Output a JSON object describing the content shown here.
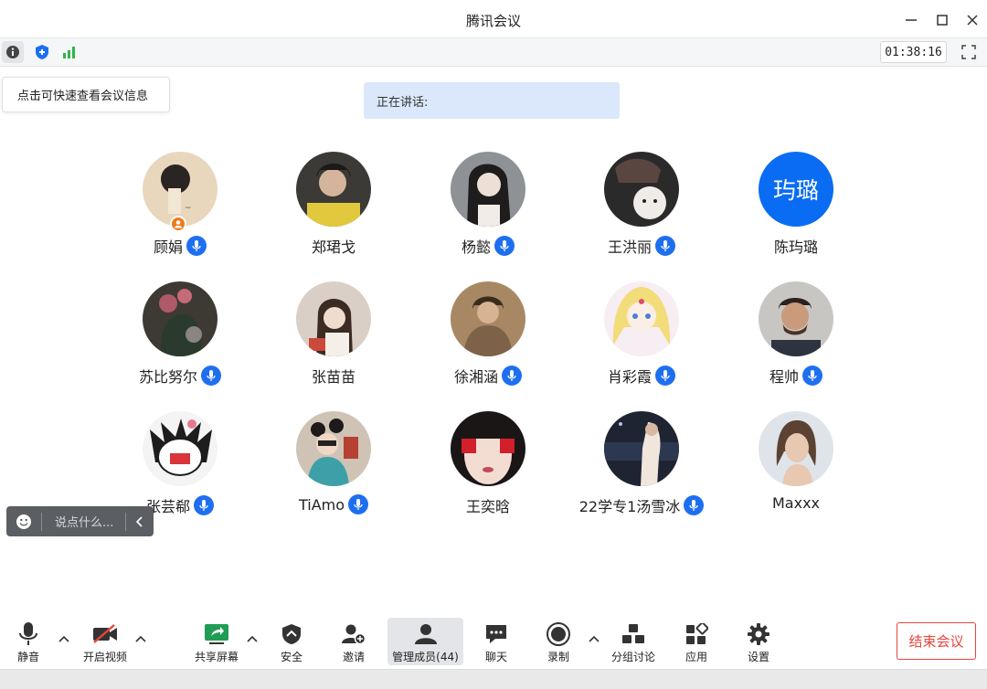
{
  "window": {
    "title": "腾讯会议"
  },
  "infobar": {
    "timer": "01:38:16"
  },
  "tooltip": {
    "text": "点击可快速查看会议信息"
  },
  "speaking": {
    "label": "正在讲话:"
  },
  "participants": [
    {
      "name": "顾娟",
      "mic": true,
      "host": true,
      "avatar_initials": ""
    },
    {
      "name": "郑珺戈",
      "mic": false,
      "host": false,
      "avatar_initials": ""
    },
    {
      "name": "杨懿",
      "mic": true,
      "host": false,
      "avatar_initials": ""
    },
    {
      "name": "王洪丽",
      "mic": true,
      "host": false,
      "avatar_initials": ""
    },
    {
      "name": "陈玙璐",
      "mic": false,
      "host": false,
      "avatar_initials": "玙璐"
    },
    {
      "name": "苏比努尔",
      "mic": true,
      "host": false,
      "avatar_initials": ""
    },
    {
      "name": "张苗苗",
      "mic": false,
      "host": false,
      "avatar_initials": ""
    },
    {
      "name": "徐湘涵",
      "mic": true,
      "host": false,
      "avatar_initials": ""
    },
    {
      "name": "肖彩霞",
      "mic": true,
      "host": false,
      "avatar_initials": ""
    },
    {
      "name": "程帅",
      "mic": true,
      "host": false,
      "avatar_initials": ""
    },
    {
      "name": "张芸郗",
      "mic": true,
      "host": false,
      "avatar_initials": ""
    },
    {
      "name": "TiAmo",
      "mic": true,
      "host": false,
      "avatar_initials": ""
    },
    {
      "name": "王奕晗",
      "mic": false,
      "host": false,
      "avatar_initials": ""
    },
    {
      "name": "22学专1汤雪冰",
      "mic": true,
      "host": false,
      "avatar_initials": ""
    },
    {
      "name": "Maxxx",
      "mic": false,
      "host": false,
      "avatar_initials": ""
    }
  ],
  "chat": {
    "placeholder": "说点什么..."
  },
  "toolbar": {
    "mute": "静音",
    "video": "开启视频",
    "share": "共享屏幕",
    "security": "安全",
    "invite": "邀请",
    "members": "管理成员(44)",
    "chat": "聊天",
    "record": "录制",
    "breakout": "分组讨论",
    "apps": "应用",
    "settings": "设置",
    "end": "结束会议"
  },
  "colors": {
    "accent": "#1e6ff0",
    "end_red": "#e8453c",
    "speaking_bg": "#dbe8fb",
    "signal_green": "#2fb64a",
    "host_orange": "#f07b1d"
  }
}
